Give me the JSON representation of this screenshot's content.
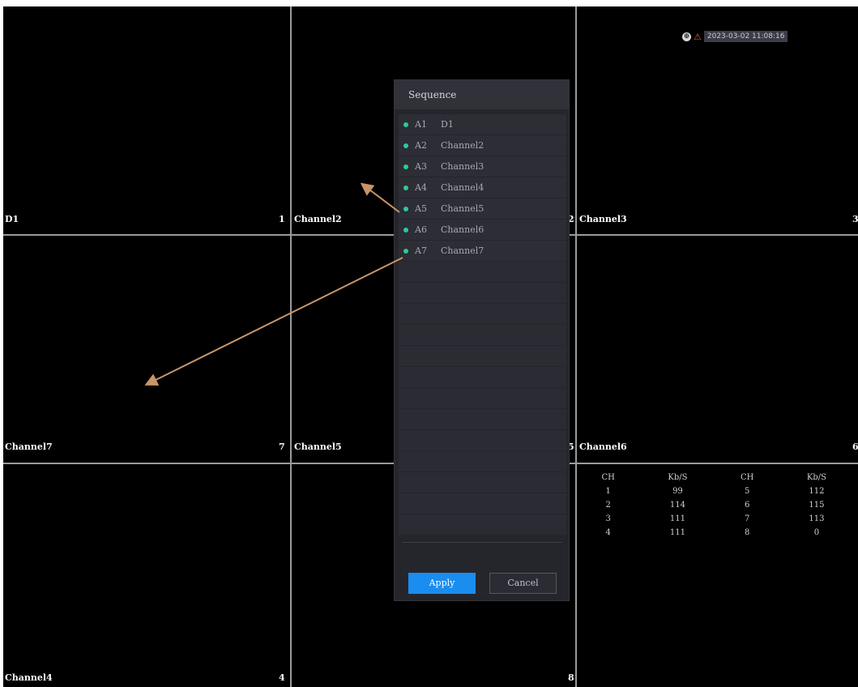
{
  "cells": [
    {
      "label": "D1",
      "num": "1"
    },
    {
      "label": "Channel2",
      "num": "2"
    },
    {
      "label": "Channel3",
      "num": "3"
    },
    {
      "label": "Channel7",
      "num": "7"
    },
    {
      "label": "Channel5",
      "num": "5"
    },
    {
      "label": "Channel6",
      "num": "6"
    },
    {
      "label": "Channel4",
      "num": "4"
    },
    {
      "label": "",
      "num": "8"
    }
  ],
  "status": {
    "datetime": "2023-03-02 11:08:16",
    "rec_icon": "record-status-icon",
    "alarm_icon": "alarm-warning-icon"
  },
  "bitrate_table": {
    "headers": [
      "CH",
      "Kb/S",
      "CH",
      "Kb/S"
    ],
    "rows": [
      [
        "1",
        "99",
        "5",
        "112"
      ],
      [
        "2",
        "114",
        "6",
        "115"
      ],
      [
        "3",
        "111",
        "7",
        "113"
      ],
      [
        "4",
        "111",
        "8",
        "0"
      ]
    ]
  },
  "dialog": {
    "title": "Sequence",
    "items": [
      {
        "num": "A1",
        "name": "D1"
      },
      {
        "num": "A2",
        "name": "Channel2"
      },
      {
        "num": "A3",
        "name": "Channel3"
      },
      {
        "num": "A4",
        "name": "Channel4"
      },
      {
        "num": "A5",
        "name": "Channel5"
      },
      {
        "num": "A6",
        "name": "Channel6"
      },
      {
        "num": "A7",
        "name": "Channel7"
      }
    ],
    "apply_label": "Apply",
    "cancel_label": "Cancel"
  },
  "colors": {
    "accent": "#1a8df0",
    "status_dot": "#2fc99a",
    "annotation_arrow": "#c8956a"
  }
}
